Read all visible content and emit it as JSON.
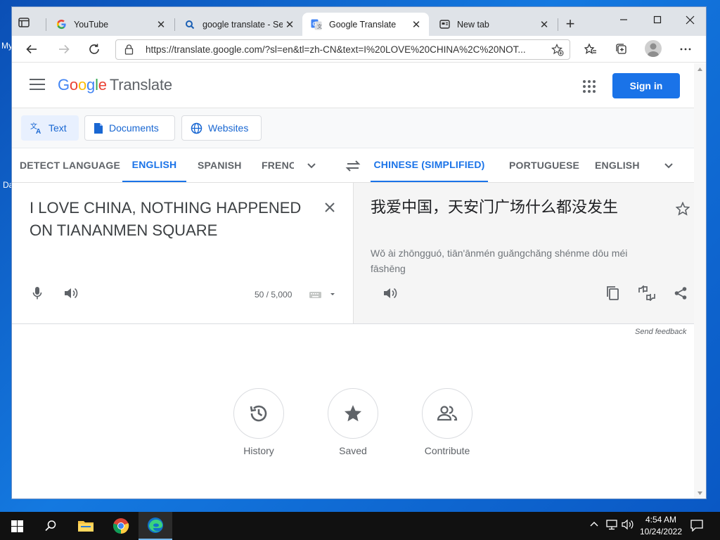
{
  "desktop": {
    "labels": [
      "My",
      "Da"
    ]
  },
  "browser": {
    "tabs": [
      {
        "title": "YouTube",
        "icon": "google-g-icon"
      },
      {
        "title": "google translate - Search",
        "icon": "search-icon"
      },
      {
        "title": "Google Translate",
        "icon": "google-translate-icon"
      },
      {
        "title": "New tab",
        "icon": "new-tab-page-icon"
      }
    ],
    "url": "https://translate.google.com/?sl=en&tl=zh-CN&text=I%20LOVE%20CHINA%2C%20NOT..."
  },
  "header": {
    "logo_letters": [
      "G",
      "o",
      "o",
      "g",
      "l",
      "e"
    ],
    "product": "Translate",
    "signin_label": "Sign in"
  },
  "modes": {
    "text": "Text",
    "documents": "Documents",
    "websites": "Websites"
  },
  "source_langs": [
    "DETECT LANGUAGE",
    "ENGLISH",
    "SPANISH",
    "FRENCH"
  ],
  "target_langs": [
    "CHINESE (SIMPLIFIED)",
    "PORTUGUESE",
    "ENGLISH"
  ],
  "source": {
    "text": "I LOVE CHINA, NOTHING HAPPENED ON TIANANMEN SQUARE",
    "count": "50 / 5,000"
  },
  "target": {
    "text": "我爱中国，天安门广场什么都没发生",
    "transliteration": "Wǒ ài zhōngguó, tiān'ānmén guǎngchǎng shénme dōu méi fāshēng"
  },
  "feedback": "Send feedback",
  "bottom": {
    "history": "History",
    "saved": "Saved",
    "contribute": "Contribute"
  },
  "taskbar": {
    "time": "4:54 AM",
    "date": "10/24/2022"
  },
  "colors": {
    "accent": "#1a73e8",
    "desktop": "#0b5cc7"
  }
}
